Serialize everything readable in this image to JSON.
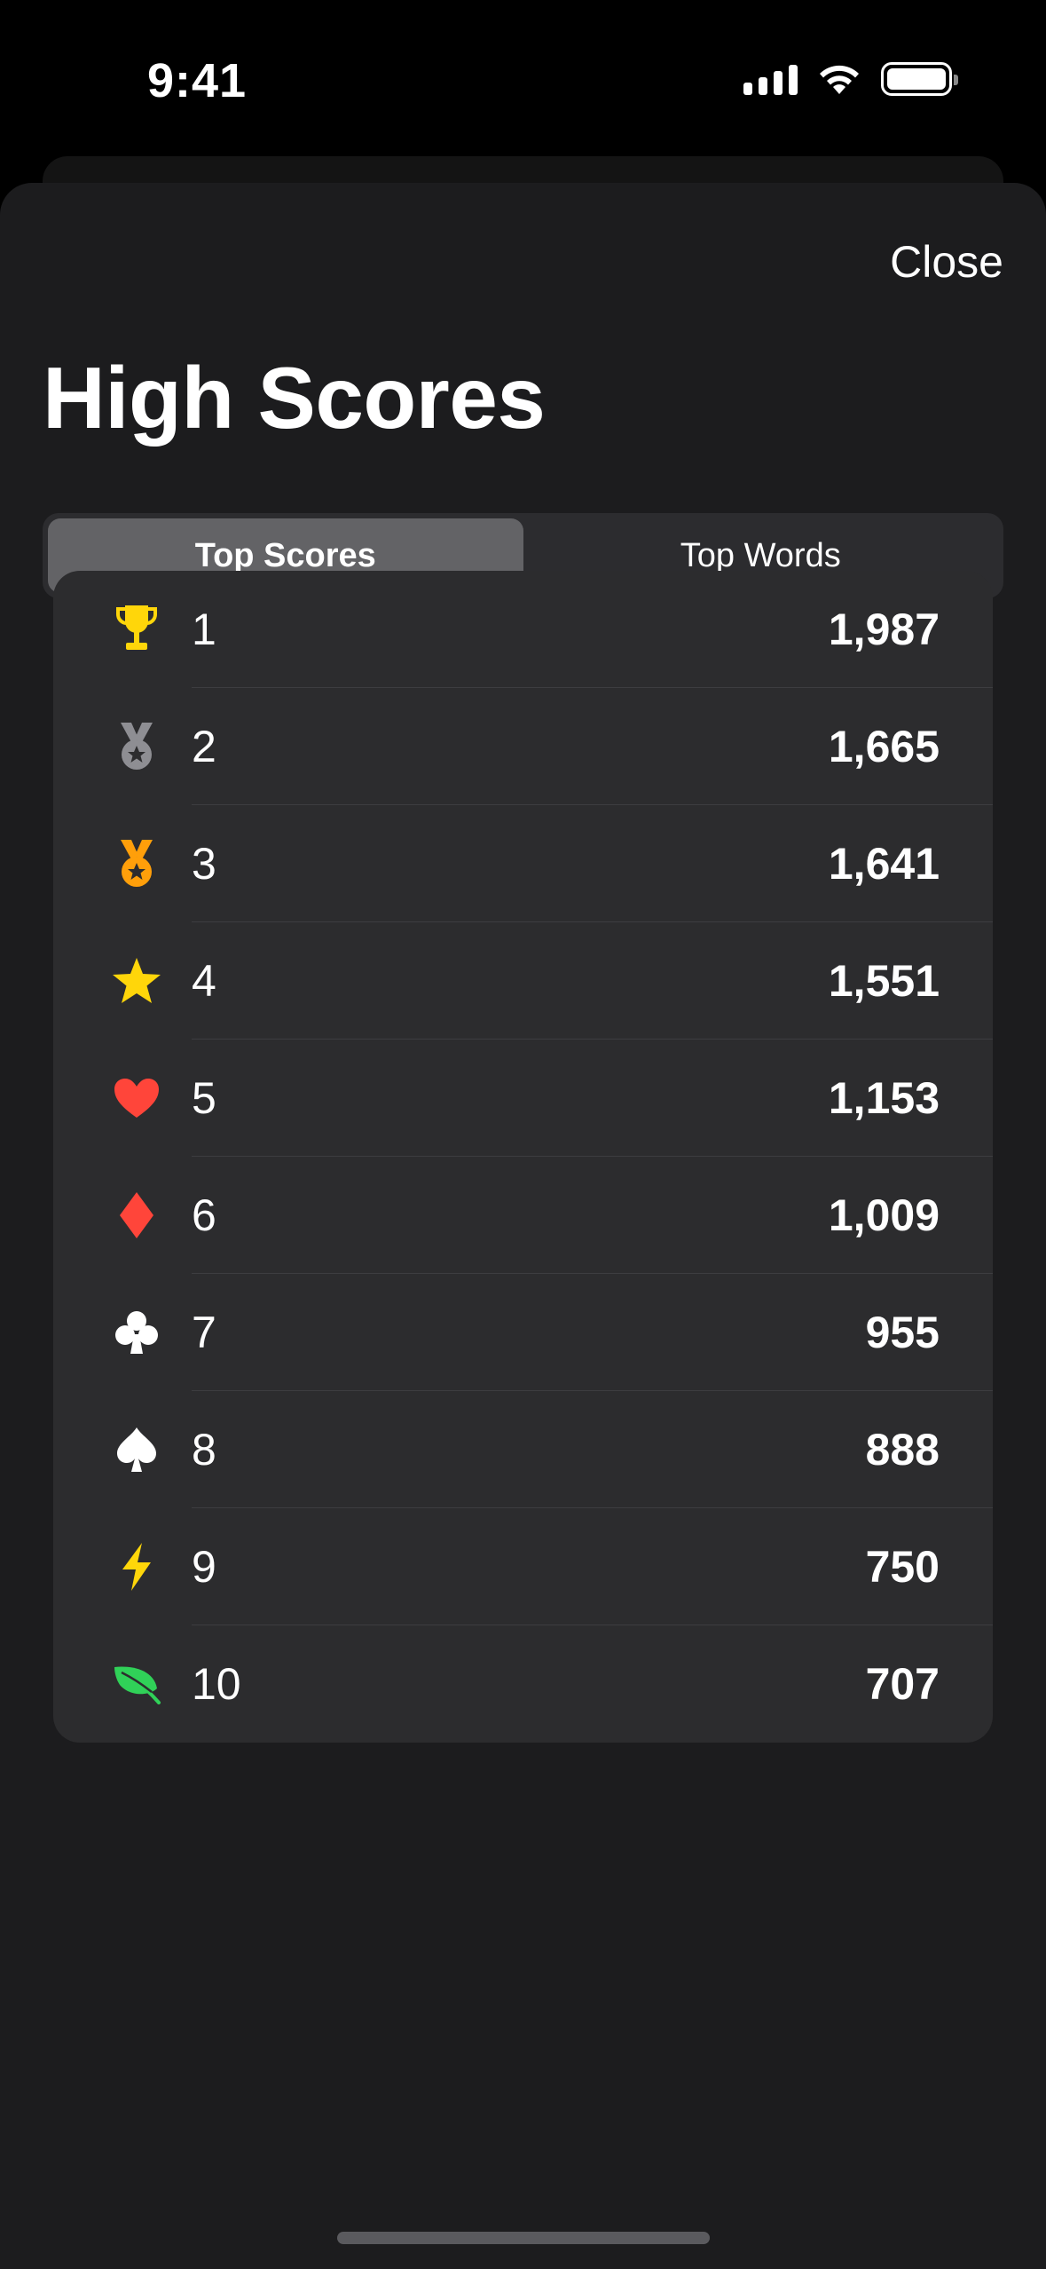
{
  "status_bar": {
    "time": "9:41"
  },
  "header": {
    "close_label": "Close",
    "title": "High Scores"
  },
  "tabs": [
    {
      "label": "Top Scores",
      "active": true
    },
    {
      "label": "Top Words",
      "active": false
    }
  ],
  "scores": [
    {
      "rank": "1",
      "score": "1,987",
      "icon": "trophy-icon",
      "color": "#ffd60a"
    },
    {
      "rank": "2",
      "score": "1,665",
      "icon": "silver-medal-icon",
      "color": "#8e8e93"
    },
    {
      "rank": "3",
      "score": "1,641",
      "icon": "bronze-medal-icon",
      "color": "#ff9f0a"
    },
    {
      "rank": "4",
      "score": "1,551",
      "icon": "star-icon",
      "color": "#ffd60a"
    },
    {
      "rank": "5",
      "score": "1,153",
      "icon": "heart-icon",
      "color": "#ff453a"
    },
    {
      "rank": "6",
      "score": "1,009",
      "icon": "diamond-icon",
      "color": "#ff453a"
    },
    {
      "rank": "7",
      "score": "955",
      "icon": "club-icon",
      "color": "#ffffff"
    },
    {
      "rank": "8",
      "score": "888",
      "icon": "spade-icon",
      "color": "#ffffff"
    },
    {
      "rank": "9",
      "score": "750",
      "icon": "bolt-icon",
      "color": "#ffd60a"
    },
    {
      "rank": "10",
      "score": "707",
      "icon": "leaf-icon",
      "color": "#30d158"
    }
  ]
}
